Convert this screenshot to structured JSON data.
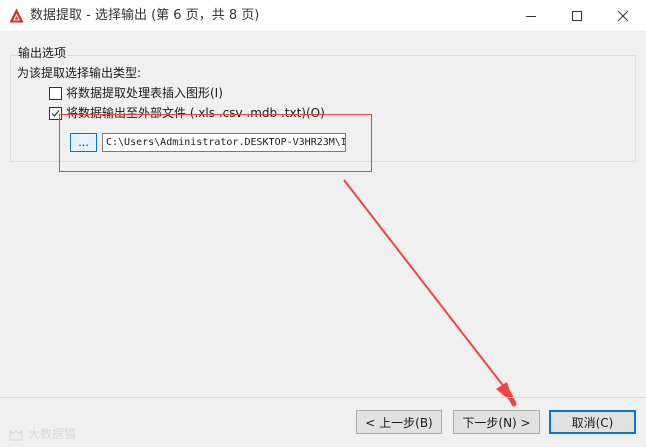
{
  "window": {
    "title": "数据提取 - 选择输出 (第 6 页，共 8 页)",
    "icon": "autocad-icon",
    "controls": {
      "minimize": "minimize-icon",
      "maximize": "maximize-icon",
      "close": "close-icon"
    }
  },
  "output_options": {
    "group_label": "输出选项",
    "prompt": "为该提取选择输出类型:",
    "insert_table": {
      "label": "将数据提取处理表插入图形(I)",
      "checked": false
    },
    "export_file": {
      "label": "将数据输出至外部文件 (.xls .csv .mdb .txt)(O)",
      "checked": true
    },
    "browse_label": "...",
    "file_path": "C:\\Users\\Administrator.DESKTOP-V3HR23M\\I"
  },
  "buttons": {
    "back": "< 上一步(B)",
    "next": "下一步(N) >",
    "cancel": "取消(C)"
  },
  "watermark": {
    "text": "大数据猫"
  },
  "colors": {
    "annotation": "#ee4444",
    "focus": "#0078d7",
    "app_icon": "#d92b2b"
  }
}
